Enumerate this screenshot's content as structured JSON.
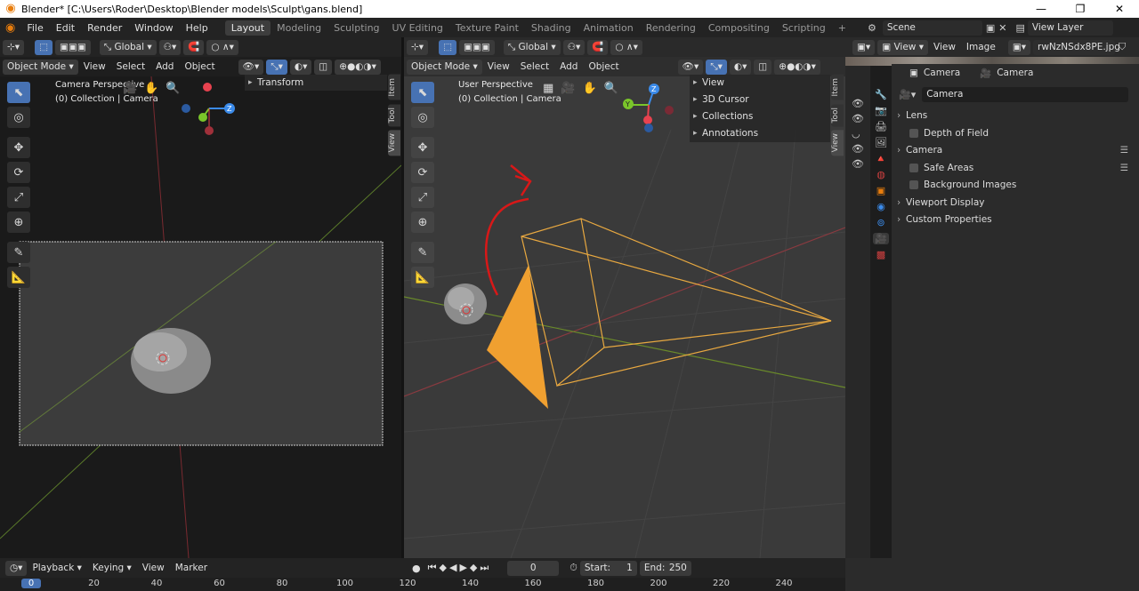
{
  "window": {
    "title": "Blender* [C:\\Users\\Roder\\Desktop\\Blender models\\Sculpt\\gans.blend]",
    "minimize": "—",
    "maximize": "❐",
    "close": "✕"
  },
  "menu": [
    "File",
    "Edit",
    "Render",
    "Window",
    "Help"
  ],
  "workspaces": [
    "Layout",
    "Modeling",
    "Sculpting",
    "UV Editing",
    "Texture Paint",
    "Shading",
    "Animation",
    "Rendering",
    "Compositing",
    "Scripting",
    "+"
  ],
  "scene": {
    "label": "Scene",
    "view_layer": "View Layer"
  },
  "left_viewport": {
    "transform_orientation": "Global",
    "mode": "Object Mode",
    "menu": [
      "View",
      "Select",
      "Add",
      "Object"
    ],
    "overlay_title": "Camera Perspective",
    "overlay_sub": "(0) Collection | Camera",
    "npanel_rows": [
      "Transform"
    ],
    "tabs": [
      "Item",
      "Tool",
      "View"
    ]
  },
  "right_viewport": {
    "transform_orientation": "Global",
    "mode": "Object Mode",
    "menu": [
      "View",
      "Select",
      "Add",
      "Object"
    ],
    "overlay_title": "User Perspective",
    "overlay_sub": "(0) Collection | Camera",
    "npanel_rows": [
      "View",
      "3D Cursor",
      "Collections",
      "Annotations"
    ],
    "tabs": [
      "Item",
      "Tool",
      "View"
    ]
  },
  "image_editor": {
    "menu": [
      "View",
      "View",
      "Image"
    ],
    "image_name": "rwNzNSdx8PE.jpg"
  },
  "properties": {
    "breadcrumb_object": "Camera",
    "breadcrumb_data": "Camera",
    "datablock": "Camera",
    "panels": [
      {
        "label": "Lens",
        "checkbox": false,
        "indent": false
      },
      {
        "label": "Depth of Field",
        "checkbox": true,
        "indent": true
      },
      {
        "label": "Camera",
        "checkbox": false,
        "indent": false
      },
      {
        "label": "Safe Areas",
        "checkbox": true,
        "indent": true
      },
      {
        "label": "Background Images",
        "checkbox": true,
        "indent": true
      },
      {
        "label": "Viewport Display",
        "checkbox": false,
        "indent": false
      },
      {
        "label": "Custom Properties",
        "checkbox": false,
        "indent": false
      }
    ]
  },
  "timeline": {
    "menu": [
      "Playback",
      "Keying",
      "View",
      "Marker"
    ],
    "current_frame": "0",
    "start_label": "Start:",
    "start": "1",
    "end_label": "End:",
    "end": "250",
    "ruler": [
      "0",
      "20",
      "40",
      "60",
      "80",
      "100",
      "120",
      "140",
      "160",
      "180",
      "200",
      "220",
      "240"
    ]
  },
  "colors": {
    "accent": "#4772b3",
    "camera_orange": "#f0a030",
    "annotation_red": "#e0141e",
    "axis_x": "#e8424f",
    "axis_y": "#7ac52a",
    "axis_z": "#3b8bea"
  }
}
